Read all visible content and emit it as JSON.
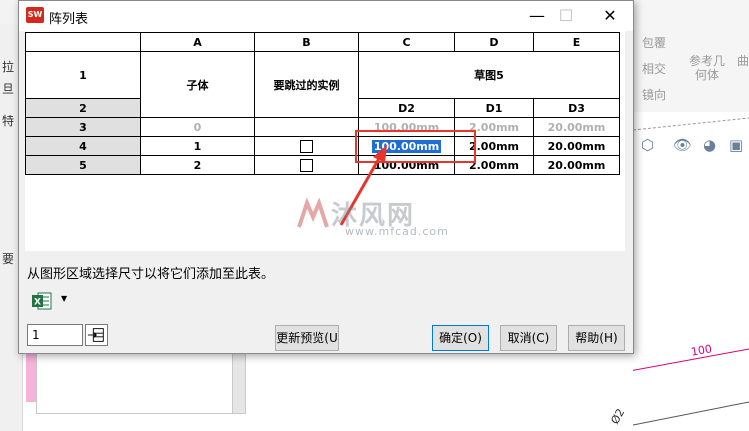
{
  "window": {
    "title": "阵列表",
    "app_icon_text": "SW",
    "minimize": "—",
    "maximize": "☐",
    "close": "✕"
  },
  "background": {
    "ribbon_items": [
      "包覆",
      "相交",
      "参考几",
      "何体",
      "镜向",
      "曲"
    ],
    "side_texts": [
      "拉",
      "旦",
      "特",
      "要"
    ],
    "dimension_label": "100",
    "dimension_label2": "Ø2"
  },
  "table": {
    "column_letters": [
      "A",
      "B",
      "C",
      "D",
      "E"
    ],
    "header_row1": {
      "label": "1",
      "col_a": "子体",
      "col_b": "要跳过的实例",
      "cde": "草图5"
    },
    "header_row2": {
      "label": "2",
      "col_c": "D2",
      "col_d": "D1",
      "col_e": "D3"
    },
    "rows": [
      {
        "label": "3",
        "a": "0",
        "c": "100.00mm",
        "d": "2.00mm",
        "e": "20.00mm",
        "greyed": true
      },
      {
        "label": "4",
        "a": "1",
        "c": "100.00mm",
        "d": "2.00mm",
        "e": "20.00mm",
        "selected": true
      },
      {
        "label": "5",
        "a": "2",
        "c": "100.00mm",
        "d": "2.00mm",
        "e": "20.00mm"
      }
    ]
  },
  "watermark": {
    "text": "沐风网",
    "sub": "www.mfcad.com"
  },
  "status_text": "从图形区域选择尺寸以将它们添加至此表。",
  "rows_input_value": "1",
  "buttons": {
    "update_preview": "更新预览(U",
    "ok": "确定(O)",
    "cancel": "取消(C)",
    "help": "帮助(H)"
  },
  "colors": {
    "highlight": "#e8352c",
    "selection": "#1e6ed4",
    "dimension": "#d6007a"
  }
}
